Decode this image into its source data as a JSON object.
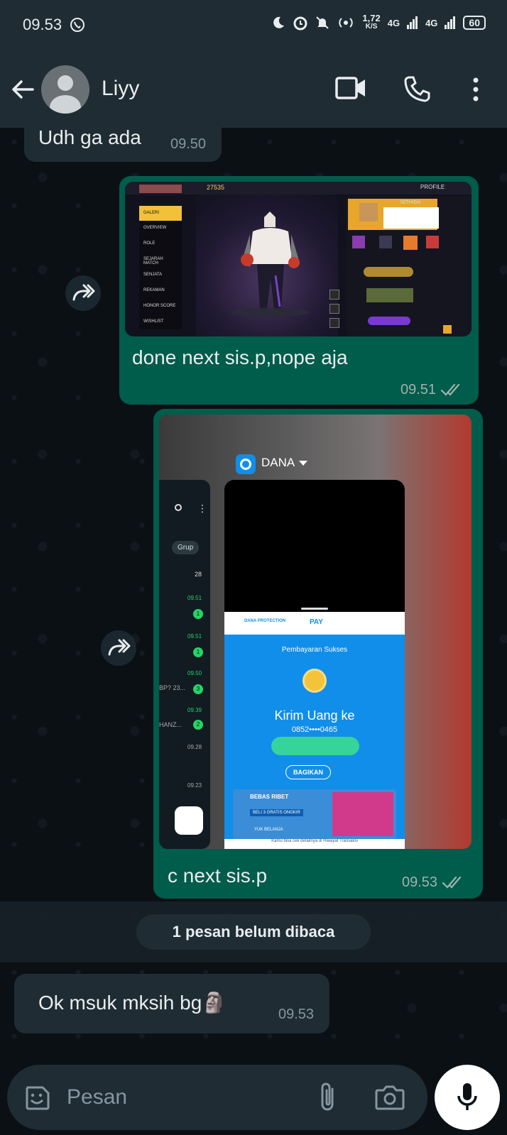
{
  "status_bar": {
    "time": "09.53",
    "speed_value": "1,72",
    "speed_unit": "K/S",
    "net1": "4G",
    "net2": "4G",
    "battery": "60"
  },
  "header": {
    "contact_name": "Liyy"
  },
  "messages": [
    {
      "direction": "in",
      "text": "Udh ga ada",
      "time": "09.50"
    },
    {
      "direction": "out",
      "forwarded": true,
      "caption": "done next sis.p,nope aja",
      "time": "09.51",
      "ticks": "double-check"
    },
    {
      "direction": "out",
      "forwarded": true,
      "caption": "c next sis.p",
      "time": "09.53",
      "ticks": "double-check"
    },
    {
      "direction": "in",
      "text": "Ok msuk mksih bg🗿",
      "time": "09.53"
    }
  ],
  "screenshot1": {
    "profile": "PROFILE",
    "coins": "27535",
    "menu": [
      "GALERI",
      "OVERVIEW",
      "ROLE",
      "SEJARAH MATCH",
      "SENJATA",
      "REKAMAN",
      "HONOR SCORE",
      "WISHLIST"
    ],
    "player_id": "NITHISH"
  },
  "screenshot2": {
    "app_name": "DANA",
    "tab_label": "Grup",
    "list_times": [
      "28",
      "09.51",
      "09.51",
      "09.50",
      "09.39",
      "09.28",
      "09.23"
    ],
    "list_badges": [
      "1",
      "1",
      "3",
      "2"
    ],
    "list_snippets": [
      "BP? 23...",
      "HANZ..."
    ],
    "dana_protection": "DANA PROTECTION",
    "pay": "PAY",
    "payment_status": "Pembayaran Sukses",
    "transfer_title": "Kirim Uang ke",
    "phone_masked": "0852••••0465",
    "share_label": "BAGIKAN",
    "promo_title": "BEBAS RIBET",
    "promo_sub": "BELI 3 GRATIS ONGKIR",
    "promo_cta": "YUK BELANJA",
    "history_hint": "Kamu bisa cek detailnya di Riwayat Transaksi"
  },
  "unread_banner": "1 pesan belum dibaca",
  "input": {
    "placeholder": "Pesan"
  },
  "colors": {
    "header_bg": "#1f2c34",
    "incoming_bubble": "#1f2c34",
    "outgoing_bubble": "#005c4b",
    "chat_bg": "#0b1014",
    "dana_blue": "#118ee9"
  },
  "icons": [
    "back-arrow-icon",
    "video-call-icon",
    "phone-icon",
    "more-vert-icon",
    "forward-icon",
    "sticker-icon",
    "attach-icon",
    "camera-icon",
    "mic-icon"
  ]
}
